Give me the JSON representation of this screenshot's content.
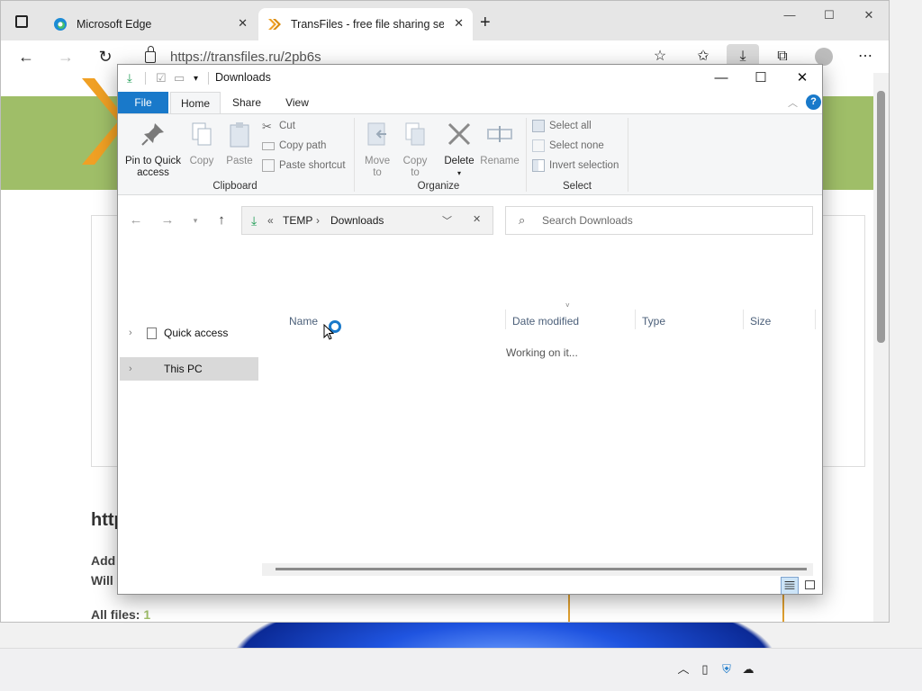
{
  "browser": {
    "tabs": [
      {
        "label": "Microsoft Edge",
        "active": false
      },
      {
        "label": "TransFiles - free file sharing serv",
        "active": true
      }
    ],
    "url_host": "https://transfiles.ru",
    "url_path": "/2pb6s",
    "page": {
      "heading_fragment": "http",
      "line1": "Add",
      "line2": "Will",
      "all_files_label": "All files:",
      "all_files_count": "1"
    }
  },
  "explorer": {
    "title": "Downloads",
    "ribbon_tabs": [
      "File",
      "Home",
      "Share",
      "View"
    ],
    "clipboard": {
      "pin": "Pin to Quick access",
      "copy": "Copy",
      "paste": "Paste",
      "cut": "Cut",
      "copy_path": "Copy path",
      "paste_shortcut": "Paste shortcut",
      "label": "Clipboard"
    },
    "organize": {
      "move_to": "Move to",
      "copy_to": "Copy to",
      "delete": "Delete",
      "rename": "Rename",
      "label": "Organize"
    },
    "select": {
      "select_all": "Select all",
      "select_none": "Select none",
      "invert": "Invert selection",
      "label": "Select"
    },
    "address": {
      "prefix": "«",
      "part1": "TEMP",
      "sep": "›",
      "part2": "Downloads"
    },
    "search_placeholder": "Search Downloads",
    "nav": [
      {
        "label": "Quick access"
      },
      {
        "label": "This PC",
        "selected": true
      }
    ],
    "columns": [
      "Name",
      "Date modified",
      "Type",
      "Size"
    ],
    "status": "Working on it..."
  },
  "colors": {
    "file_tab": "#1979ca",
    "banner": "#9fbe68",
    "accent": "#1979ca"
  }
}
